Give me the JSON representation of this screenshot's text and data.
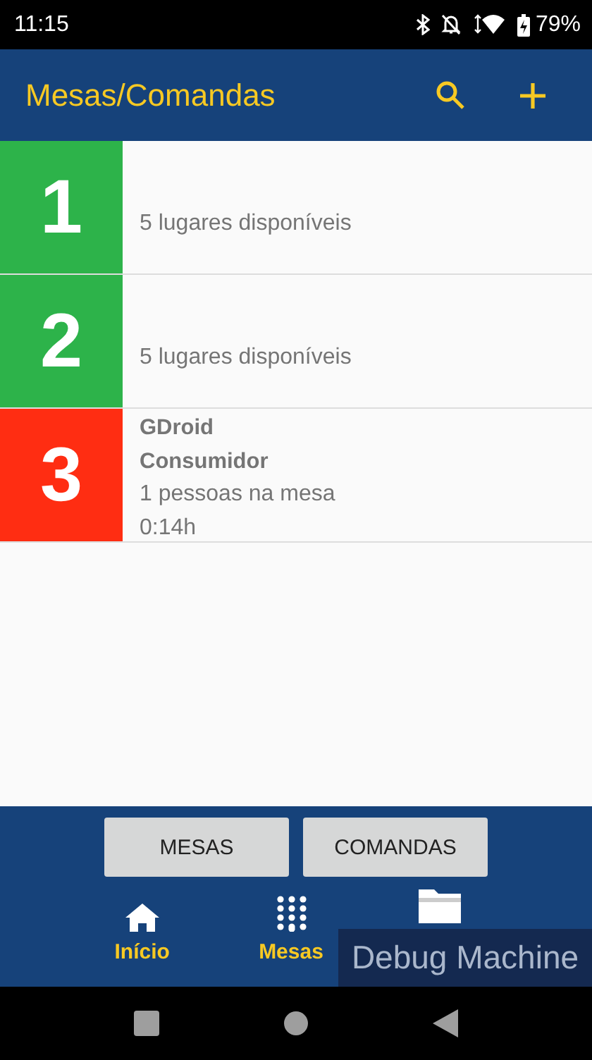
{
  "status_bar": {
    "time": "11:15",
    "battery": "79%"
  },
  "app_bar": {
    "title": "Mesas/Comandas",
    "actions": [
      {
        "kind": "search"
      },
      {
        "kind": "add"
      }
    ]
  },
  "tables": [
    {
      "number": "1",
      "color": "#2db34a",
      "lines": [
        {
          "text": "5 lugares disponíveis",
          "kind": "plain"
        }
      ]
    },
    {
      "number": "2",
      "color": "#2db34a",
      "lines": [
        {
          "text": "5 lugares disponíveis",
          "kind": "plain"
        }
      ]
    },
    {
      "number": "3",
      "color": "#ff2d12",
      "lines": [
        {
          "text": "GDroid",
          "kind": "bold"
        },
        {
          "text": "Consumidor",
          "kind": "bold"
        },
        {
          "text": "1 pessoas na mesa",
          "kind": "plain"
        },
        {
          "text": "0:14h",
          "kind": "plain"
        }
      ]
    }
  ],
  "mode_buttons": [
    "MESAS",
    "COMANDAS"
  ],
  "bottom_nav": [
    {
      "label": "Início",
      "kind": "home"
    },
    {
      "label": "Mesas",
      "kind": "dialpad"
    },
    {
      "kind": "folder"
    }
  ],
  "overlay": {
    "text": "Debug Machine"
  }
}
